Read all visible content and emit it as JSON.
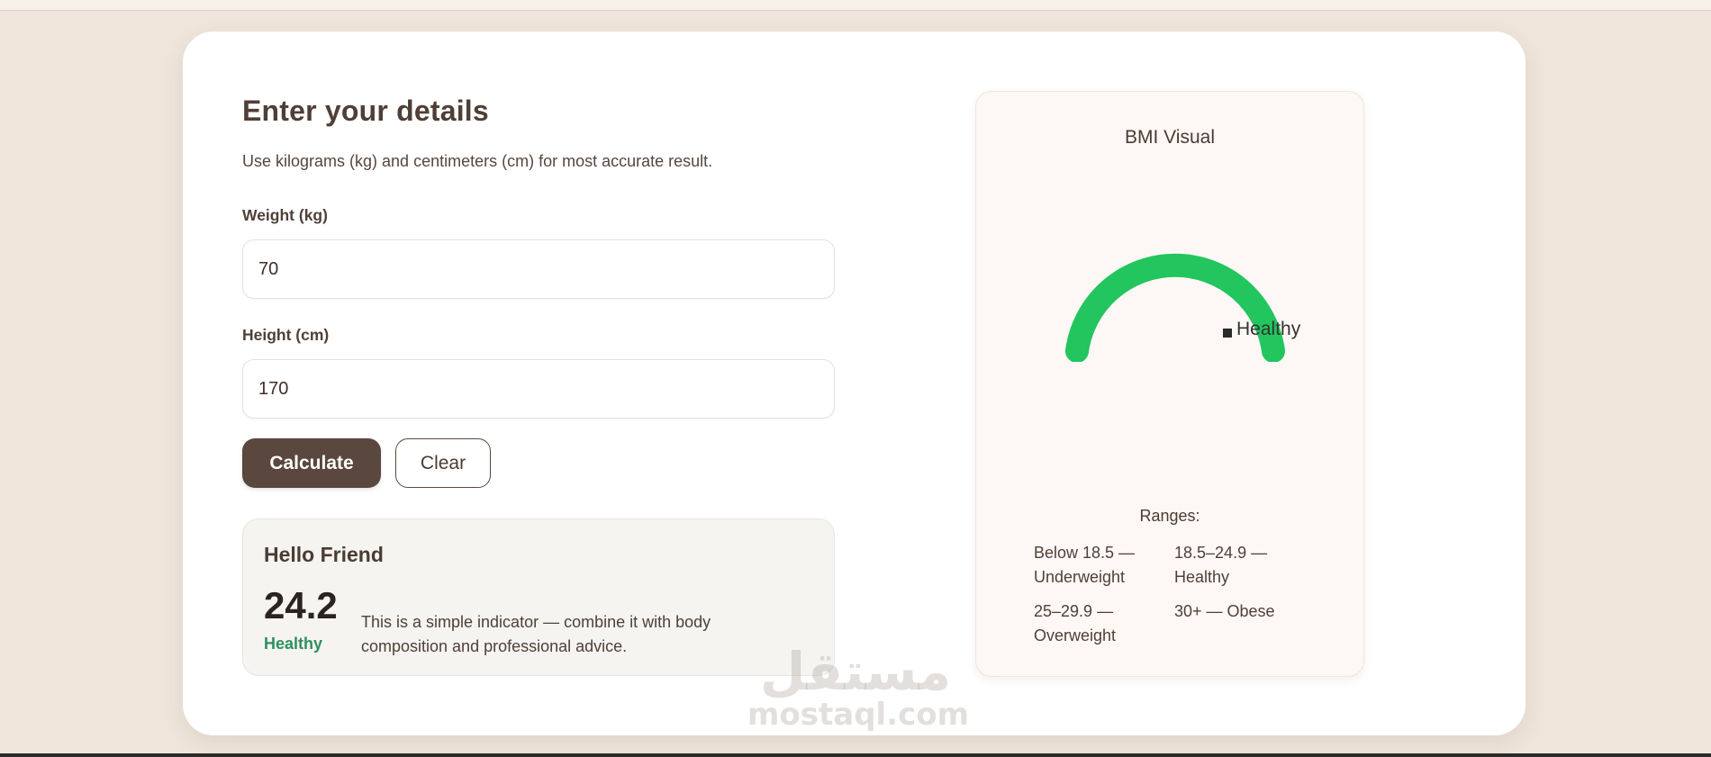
{
  "form": {
    "title": "Enter your details",
    "hint": "Use kilograms (kg) and centimeters (cm) for most accurate result.",
    "weight_label": "Weight (kg)",
    "weight_value": "70",
    "height_label": "Height (cm)",
    "height_value": "170",
    "calculate_label": "Calculate",
    "clear_label": "Clear"
  },
  "result": {
    "greeting": "Hello Friend",
    "bmi": "24.2",
    "status": "Healthy",
    "note": "This is a simple indicator — combine it with body composition and professional advice."
  },
  "visual": {
    "title": "BMI Visual",
    "legend": "Healthy",
    "gauge_color": "#22c55e",
    "ranges_title": "Ranges:",
    "ranges": [
      "Below 18.5 — Underweight",
      "18.5–24.9 — Healthy",
      "25–29.9 — Overweight",
      "30+ — Obese"
    ]
  },
  "watermark": {
    "arabic": "مستقل",
    "latin": "mostaql.com"
  }
}
